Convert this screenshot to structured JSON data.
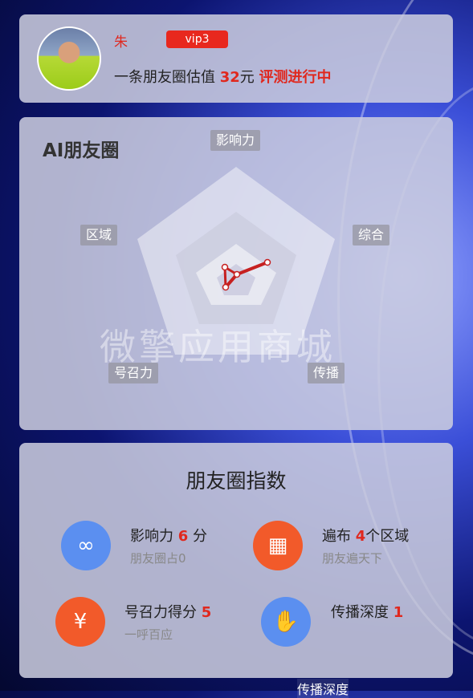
{
  "profile": {
    "username": "朱",
    "vip": "vip3",
    "valuation_prefix": "一条朋友圈估值 ",
    "valuation_amount": "32",
    "valuation_unit": "元 ",
    "status": "评测进行中"
  },
  "radar": {
    "title": "AI朋友圈",
    "axes": {
      "influence": "影响力",
      "overall": "综合",
      "spread": "传播",
      "appeal": "号召力",
      "region": "区域"
    },
    "watermark": "微擎应用商城"
  },
  "index": {
    "title": "朋友圈指数",
    "influence": {
      "label": "影响力 ",
      "value": "6",
      "unit": " 分",
      "sub": "朋友圈占0"
    },
    "region": {
      "label": "遍布 ",
      "value": "4",
      "unit": "个区域",
      "sub": "朋友遍天下"
    },
    "appeal": {
      "label": "号召力得分 ",
      "value": "5",
      "sub": "一呼百应"
    },
    "depth": {
      "label": "传播深度 ",
      "value": "1"
    }
  },
  "bottom_cut_text": "传播深度",
  "colors": {
    "red": "#e0281e",
    "blue_icon": "#5b8ff0",
    "orange_icon": "#f25a2a"
  }
}
